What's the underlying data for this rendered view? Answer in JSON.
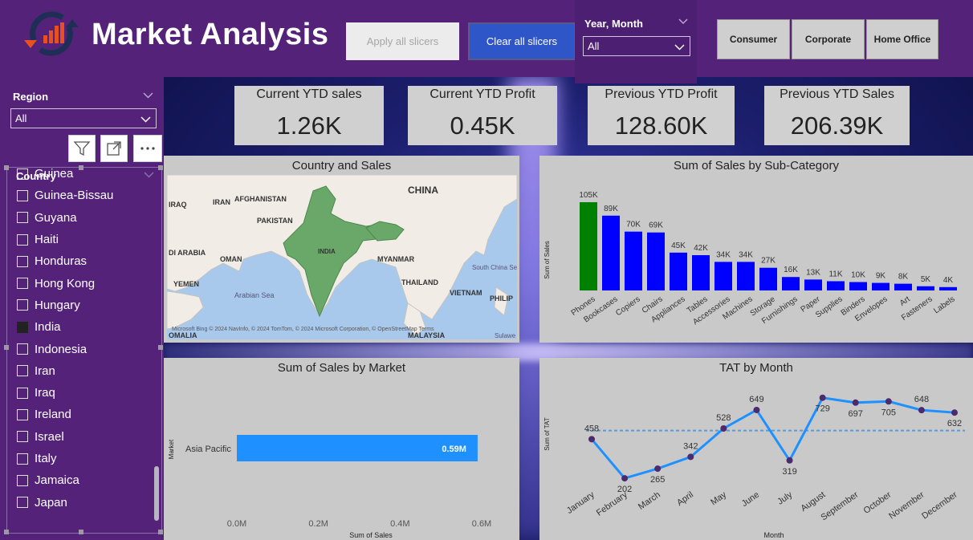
{
  "header": {
    "title": "Market Analysis",
    "apply_label": "Apply all slicers",
    "clear_label": "Clear all slicers",
    "year_month_label": "Year, Month",
    "year_month_value": "All",
    "segments": [
      "Consumer",
      "Corporate",
      "Home Office"
    ],
    "colors": {
      "bg": "#542279",
      "clear_btn": "#2f56c8"
    }
  },
  "left_panel": {
    "region_label": "Region",
    "region_value": "All",
    "icons": [
      "filter-icon",
      "expand-icon",
      "more-options-icon"
    ],
    "country_label": "Country",
    "countries": [
      {
        "name": "Guinea",
        "checked": false
      },
      {
        "name": "Guinea-Bissau",
        "checked": false
      },
      {
        "name": "Guyana",
        "checked": false
      },
      {
        "name": "Haiti",
        "checked": false
      },
      {
        "name": "Honduras",
        "checked": false
      },
      {
        "name": "Hong Kong",
        "checked": false
      },
      {
        "name": "Hungary",
        "checked": false
      },
      {
        "name": "India",
        "checked": true
      },
      {
        "name": "Indonesia",
        "checked": false
      },
      {
        "name": "Iran",
        "checked": false
      },
      {
        "name": "Iraq",
        "checked": false
      },
      {
        "name": "Ireland",
        "checked": false
      },
      {
        "name": "Israel",
        "checked": false
      },
      {
        "name": "Italy",
        "checked": false
      },
      {
        "name": "Jamaica",
        "checked": false
      },
      {
        "name": "Japan",
        "checked": false
      }
    ]
  },
  "kpis": [
    {
      "label": "Current YTD sales",
      "value": "1.26K"
    },
    {
      "label": "Current YTD Profit",
      "value": "0.45K"
    },
    {
      "label": "Previous YTD Profit",
      "value": "128.60K"
    },
    {
      "label": "Previous YTD Sales",
      "value": "206.39K"
    }
  ],
  "map": {
    "title": "Country and Sales",
    "labels": [
      "CHINA",
      "AFGHANISTAN",
      "IRAN",
      "IRAQ",
      "PAKISTAN",
      "INDIA",
      "MYANMAR",
      "OMAN",
      "DI ARABIA",
      "YEMEN",
      "THAILAND",
      "South China Sea",
      "VIETNAM",
      "PHILIP",
      "Arabian Sea",
      "OMALIA",
      "MALAYSIA",
      "Sulawe"
    ],
    "attribution": "Microsoft Bing © 2024 NavInfo, © 2024 TomTom, © 2024 Microsoft Corporation, © OpenStreetMap  Terms",
    "highlight_color": "#6aa86a"
  },
  "chart_data": [
    {
      "type": "bar",
      "title": "Sum of Sales by Sub-Category",
      "xlabel": "",
      "ylabel": "Sum of Sales",
      "categories": [
        "Phones",
        "Bookcases",
        "Copiers",
        "Chairs",
        "Appliances",
        "Tables",
        "Accessories",
        "Machines",
        "Storage",
        "Furnishings",
        "Paper",
        "Supplies",
        "Binders",
        "Envelopes",
        "Art",
        "Fasteners",
        "Labels"
      ],
      "values": [
        105,
        89,
        70,
        69,
        45,
        42,
        34,
        34,
        27,
        16,
        13,
        11,
        10,
        9,
        8,
        5,
        4
      ],
      "data_labels": [
        "105K",
        "89K",
        "70K",
        "69K",
        "45K",
        "42K",
        "34K",
        "34K",
        "27K",
        "16K",
        "13K",
        "11K",
        "10K",
        "9K",
        "8K",
        "5K",
        "4K"
      ],
      "unit": "K",
      "highlight_index": 0,
      "colors": {
        "highlight": "#008000",
        "bar": "#0000ff"
      }
    },
    {
      "type": "bar",
      "orientation": "horizontal",
      "title": "Sum of Sales by Market",
      "xlabel": "Sum of Sales",
      "ylabel": "Market",
      "categories": [
        "Asia Pacific"
      ],
      "values": [
        0.59
      ],
      "data_labels": [
        "0.59M"
      ],
      "xticks": [
        "0.0M",
        "0.2M",
        "0.4M",
        "0.6M"
      ],
      "xlim": [
        0,
        0.6
      ],
      "colors": {
        "bar": "#1e90ff"
      }
    },
    {
      "type": "line",
      "title": "TAT by Month",
      "xlabel": "Month",
      "ylabel": "Sum of TAT",
      "categories": [
        "January",
        "February",
        "March",
        "April",
        "May",
        "June",
        "July",
        "August",
        "September",
        "October",
        "November",
        "December"
      ],
      "values": [
        458,
        202,
        265,
        342,
        528,
        649,
        319,
        729,
        697,
        705,
        648,
        632
      ],
      "average_line": 514,
      "ylim": [
        150,
        780
      ],
      "colors": {
        "line": "#1e90ff",
        "marker": "#4b2a6e",
        "avg": "#5b9bd5"
      }
    }
  ]
}
